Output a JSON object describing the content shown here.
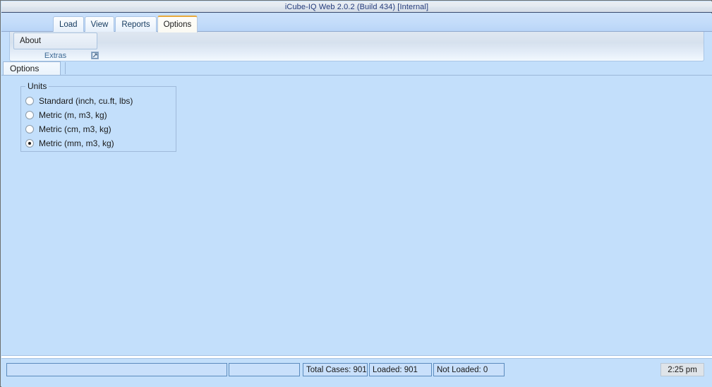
{
  "window": {
    "title": "iCube-IQ Web 2.0.2 (Build 434) [Internal]"
  },
  "ribbon": {
    "tabs": [
      {
        "label": "Load",
        "selected": false
      },
      {
        "label": "View",
        "selected": false
      },
      {
        "label": "Reports",
        "selected": false
      },
      {
        "label": "Options",
        "selected": true
      }
    ],
    "groups": [
      {
        "label": "Extras",
        "dialog_launcher_icon": "dialog-launcher-icon",
        "buttons": [
          {
            "label": "About"
          }
        ]
      }
    ]
  },
  "subtabs": [
    {
      "label": "Options",
      "selected": true
    }
  ],
  "main": {
    "groupbox": {
      "title": "Units",
      "radios": [
        {
          "label": "Standard (inch, cu.ft, lbs)",
          "checked": false
        },
        {
          "label": "Metric (m, m3, kg)",
          "checked": false
        },
        {
          "label": "Metric (cm, m3, kg)",
          "checked": false
        },
        {
          "label": "Metric (mm, m3, kg)",
          "checked": true
        }
      ]
    }
  },
  "statusbar": {
    "panels": [
      {
        "text": ""
      },
      {
        "text": ""
      },
      {
        "text": "Total Cases: 901"
      },
      {
        "text": "Loaded: 901"
      },
      {
        "text": "Not Loaded: 0"
      }
    ],
    "clock": "2:25 pm"
  },
  "colors": {
    "client_background": "#c3dffb",
    "title_text": "#233a7a",
    "selected_tab_accent": "#e8a93b",
    "group_label_text": "#3d6a95",
    "status_panel_border": "#5b8bbd"
  }
}
